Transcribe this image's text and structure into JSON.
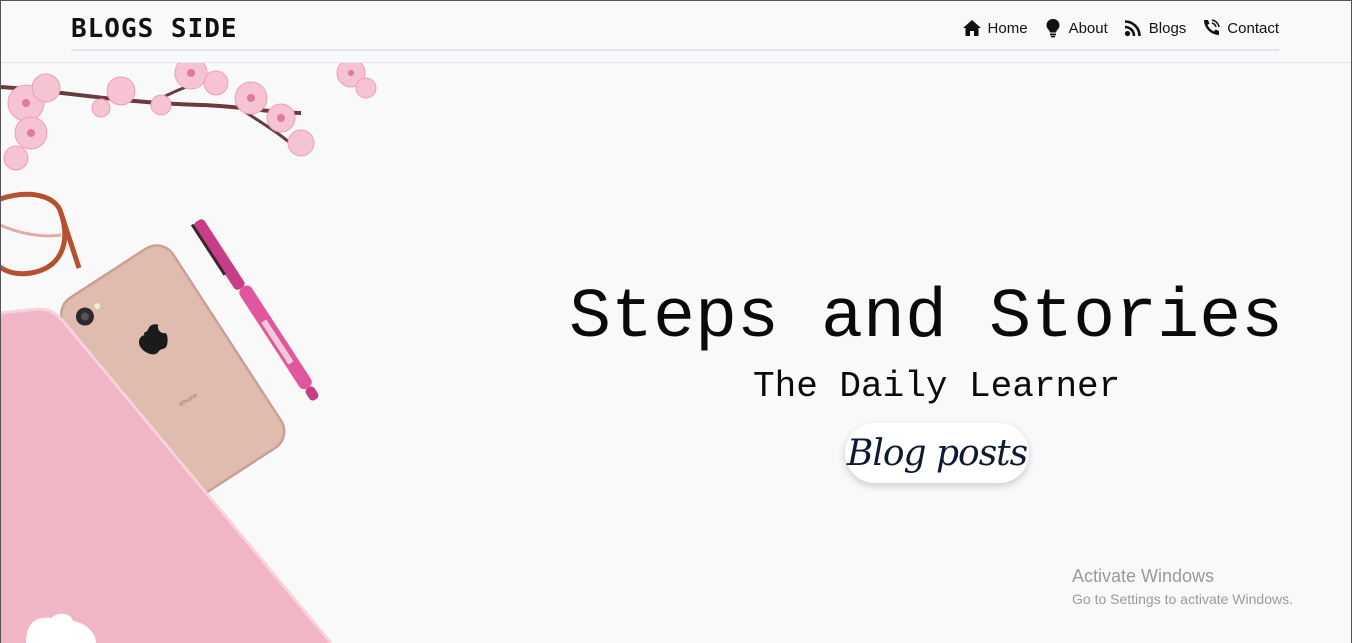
{
  "brand": "BLOGS SIDE",
  "nav": [
    {
      "label": "Home",
      "icon": "home-icon"
    },
    {
      "label": "About",
      "icon": "lightbulb-icon"
    },
    {
      "label": "Blogs",
      "icon": "blog-icon"
    },
    {
      "label": "Contact",
      "icon": "contact-icon"
    }
  ],
  "hero": {
    "title": "Steps and Stories",
    "subtitle": "The Daily Learner",
    "button_label": "Blog posts"
  },
  "watermark": {
    "title": "Activate Windows",
    "subtitle": "Go to Settings to activate Windows."
  },
  "colors": {
    "header_bg": "#f8f9fa",
    "hero_bg": "#f9f9f9",
    "button_text": "#0d1a33",
    "pink_laptop": "#f1b6c6",
    "pen_pink": "#e2569e"
  }
}
